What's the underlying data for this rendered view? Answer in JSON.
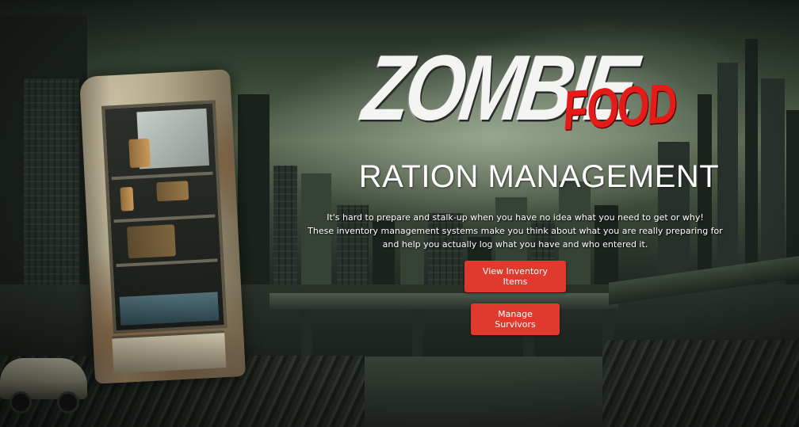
{
  "hero": {
    "logo_main": "ZOMBIE",
    "logo_accent": "FOOD",
    "subtitle": "RATION MANAGEMENT",
    "description_lines": [
      "It's hard to prepare and stalk-up when you have no idea what you need to get or why!",
      "These inventory management systems make you think about what you are really preparing for",
      "and help you actually log what you have and who entered it."
    ]
  },
  "buttons": {
    "view_inventory": "View Inventory Items",
    "manage_survivors": "Manage Survivors"
  },
  "colors": {
    "accent_red": "#e41b17",
    "button_red": "#e03a2e",
    "text_white": "#ffffff"
  }
}
